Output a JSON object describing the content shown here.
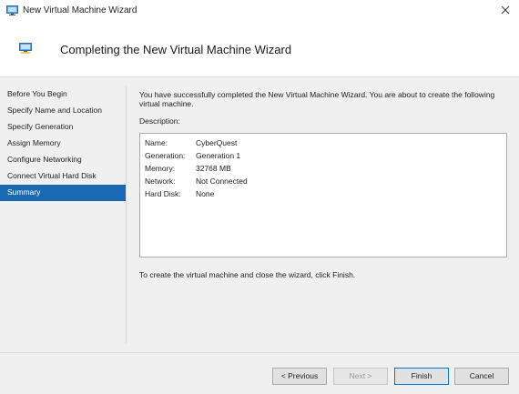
{
  "window": {
    "title": "New Virtual Machine Wizard",
    "icon": "virtual-machine-icon",
    "close_icon": "close-icon"
  },
  "header": {
    "title": "Completing the New Virtual Machine Wizard",
    "icon": "virtual-machine-icon"
  },
  "nav": {
    "items": [
      {
        "label": "Before You Begin",
        "selected": false
      },
      {
        "label": "Specify Name and Location",
        "selected": false
      },
      {
        "label": "Specify Generation",
        "selected": false
      },
      {
        "label": "Assign Memory",
        "selected": false
      },
      {
        "label": "Configure Networking",
        "selected": false
      },
      {
        "label": "Connect Virtual Hard Disk",
        "selected": false
      },
      {
        "label": "Summary",
        "selected": true
      }
    ],
    "selected_color": "#1a69b4"
  },
  "content": {
    "intro": "You have successfully completed the New Virtual Machine Wizard. You are about to create the following virtual machine.",
    "description_label": "Description:",
    "description_rows": [
      {
        "key": "Name:",
        "value": "CyberQuest"
      },
      {
        "key": "Generation:",
        "value": "Generation 1"
      },
      {
        "key": "Memory:",
        "value": "32768 MB"
      },
      {
        "key": "Network:",
        "value": "Not Connected"
      },
      {
        "key": "Hard Disk:",
        "value": "None"
      }
    ],
    "finish_note": "To create the virtual machine and close the wizard, click Finish."
  },
  "footer": {
    "previous_label": "< Previous",
    "next_label": "Next >",
    "finish_label": "Finish",
    "cancel_label": "Cancel"
  }
}
